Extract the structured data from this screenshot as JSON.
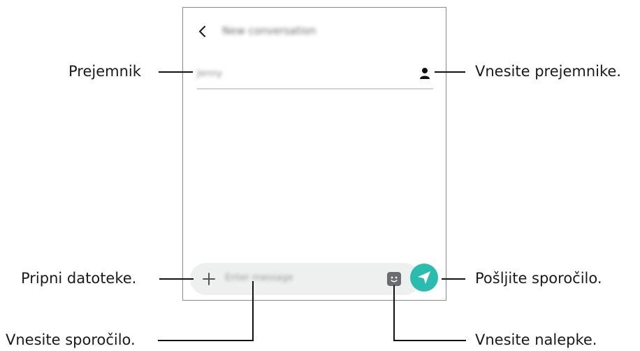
{
  "header": {
    "back_icon": "chevron-left-icon",
    "title": "New conversation"
  },
  "recipient": {
    "value": "Jenny",
    "contact_icon": "person-icon"
  },
  "composer": {
    "attach_icon": "plus-icon",
    "placeholder": "Enter message",
    "sticker_icon": "sticker-icon",
    "send_icon": "send-icon",
    "send_color": "#2bbcb0"
  },
  "annotations": {
    "recipient": "Prejemnik",
    "enter_recipients": "Vnesite prejemnike.",
    "attach_files": "Pripni datoteke.",
    "send_message": "Pošljite sporočilo.",
    "enter_message": "Vnesite sporočilo.",
    "enter_stickers": "Vnesite nalepke."
  }
}
